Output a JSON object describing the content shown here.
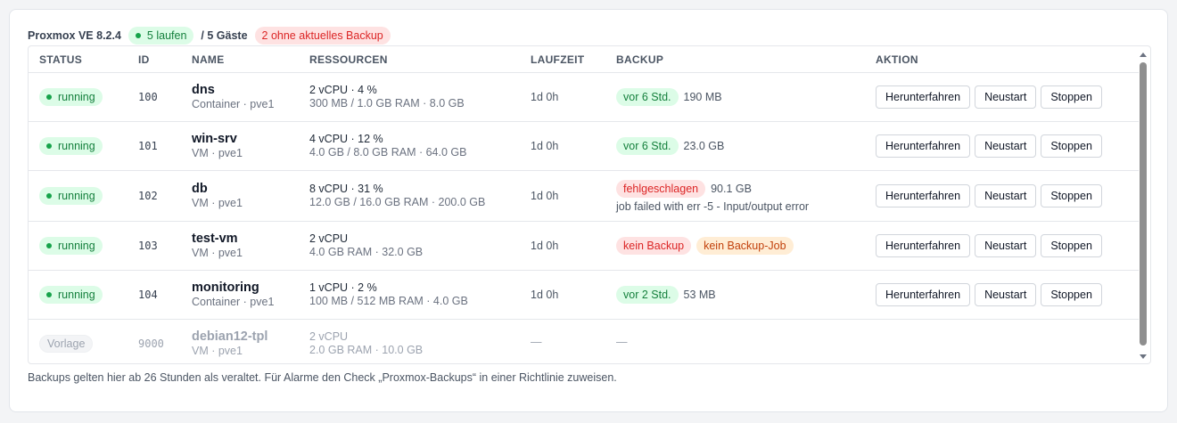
{
  "summary": {
    "version": "Proxmox VE 8.2.4",
    "running": "5 laufen",
    "guests": "/ 5 Gäste",
    "no_backup": "2 ohne aktuelles Backup"
  },
  "columns": {
    "status": "STATUS",
    "id": "ID",
    "name": "NAME",
    "resources": "RESSOURCEN",
    "uptime": "LAUFZEIT",
    "backup": "BACKUP",
    "action": "AKTION"
  },
  "actions": {
    "shutdown": "Herunterfahren",
    "restart": "Neustart",
    "stop": "Stoppen"
  },
  "rows": [
    {
      "status": "running",
      "id": "100",
      "name": "dns",
      "sub": "Container · pve1",
      "res1": "2 vCPU · 4 %",
      "res2": "300 MB / 1.0 GB RAM · 8.0 GB",
      "uptime": "1d 0h",
      "backup_badge": "vor 6 Std.",
      "backup_size": "190 MB"
    },
    {
      "status": "running",
      "id": "101",
      "name": "win-srv",
      "sub": "VM · pve1",
      "res1": "4 vCPU · 12 %",
      "res2": "4.0 GB / 8.0 GB RAM · 64.0 GB",
      "uptime": "1d 0h",
      "backup_badge": "vor 6 Std.",
      "backup_size": "23.0 GB"
    },
    {
      "status": "running",
      "id": "102",
      "name": "db",
      "sub": "VM · pve1",
      "res1": "8 vCPU · 31 %",
      "res2": "12.0 GB / 16.0 GB RAM · 200.0 GB",
      "uptime": "1d 0h",
      "backup_badge": "fehlgeschlagen",
      "backup_size": "90.1 GB",
      "backup_error": "job failed with err -5 - Input/output error"
    },
    {
      "status": "running",
      "id": "103",
      "name": "test-vm",
      "sub": "VM · pve1",
      "res1": "2 vCPU",
      "res2": "4.0 GB RAM · 32.0 GB",
      "uptime": "1d 0h",
      "backup_badge": "kein Backup",
      "backup_badge2": "kein Backup-Job"
    },
    {
      "status": "running",
      "id": "104",
      "name": "monitoring",
      "sub": "Container · pve1",
      "res1": "1 vCPU · 2 %",
      "res2": "100 MB / 512 MB RAM · 4.0 GB",
      "uptime": "1d 0h",
      "backup_badge": "vor 2 Std.",
      "backup_size": "53 MB"
    },
    {
      "status": "Vorlage",
      "id": "9000",
      "name": "debian12-tpl",
      "sub": "VM · pve1",
      "res1": "2 vCPU",
      "res2": "2.0 GB RAM · 10.0 GB",
      "uptime": "—",
      "backup_dash": "—"
    }
  ],
  "footer": "Backups gelten hier ab 26 Stunden als veraltet. Für Alarme den Check „Proxmox-Backups“ in einer Richtlinie zuweisen.",
  "colors": {
    "ok": "#16a34a",
    "error": "#dc2626",
    "warning": "#c2410c"
  }
}
